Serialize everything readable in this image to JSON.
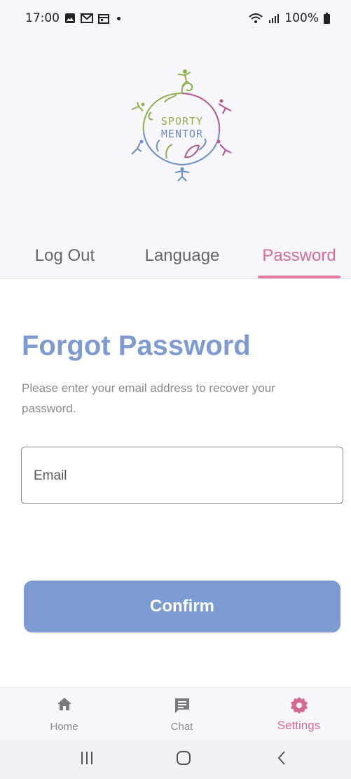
{
  "status_bar": {
    "time": "17:00",
    "battery": "100%",
    "icons": [
      "gallery-icon",
      "gmail-icon",
      "calendar-icon",
      "notification-dot",
      "wifi-icon",
      "signal-icon",
      "battery-icon"
    ]
  },
  "logo": {
    "line1": "SPORTY",
    "line2": "MENTOR"
  },
  "tabs": [
    {
      "label": "Log Out",
      "active": false
    },
    {
      "label": "Language",
      "active": false
    },
    {
      "label": "Password",
      "active": true
    }
  ],
  "main": {
    "title": "Forgot Password",
    "subtitle": "Please enter your email address to recover your password.",
    "email_placeholder": "Email",
    "confirm_label": "Confirm"
  },
  "bottom_nav": [
    {
      "label": "Home",
      "icon": "home-icon",
      "active": false
    },
    {
      "label": "Chat",
      "icon": "chat-icon",
      "active": false
    },
    {
      "label": "Settings",
      "icon": "gear-icon",
      "active": true
    }
  ],
  "colors": {
    "accent_pink": "#d76a95",
    "accent_blue": "#7c9bd2",
    "background": "#f6f6fb"
  },
  "system_nav": [
    "recent-apps-icon",
    "home-circle-icon",
    "back-icon"
  ]
}
